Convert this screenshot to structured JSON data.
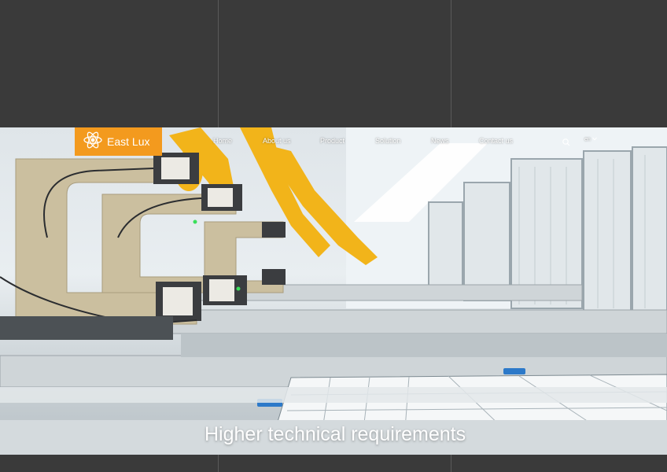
{
  "brand": {
    "name": "East Lux",
    "logo_icon": "atom-icon"
  },
  "nav": {
    "items": [
      {
        "label": "Home"
      },
      {
        "label": "About us"
      },
      {
        "label": "Product"
      },
      {
        "label": "Solution"
      },
      {
        "label": "News"
      },
      {
        "label": "Contact us"
      }
    ],
    "search_icon": "search-icon",
    "language": {
      "label": "en",
      "icon": "chevron-down-icon"
    }
  },
  "hero": {
    "caption": "Higher technical requirements",
    "image_description_icon": "factory-robot-production-line"
  },
  "colors": {
    "brand_orange": "#f39a1e",
    "page_background": "#3a3a3a",
    "text": "#ffffff"
  }
}
